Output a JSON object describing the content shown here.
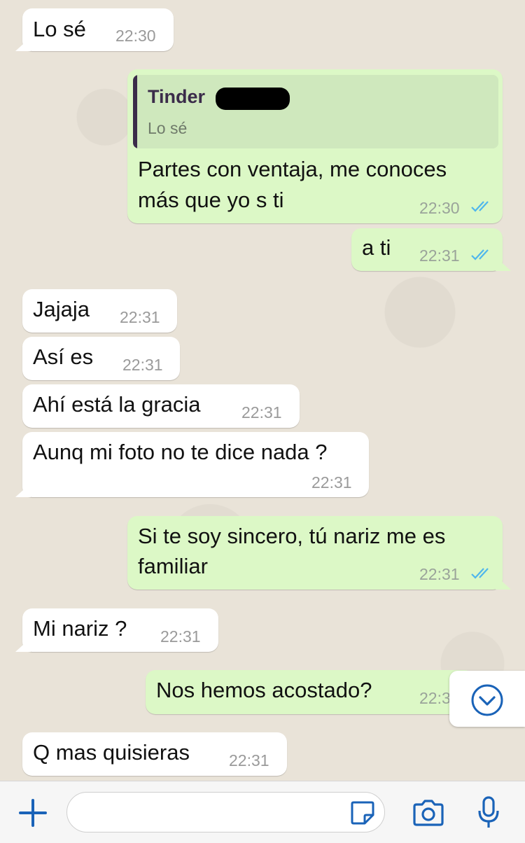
{
  "colors": {
    "outgoing_bubble": "#dcf8c6",
    "incoming_bubble": "#ffffff",
    "wallpaper": "#e9e3d8",
    "read_ticks": "#4fb6ec",
    "accent": "#1a63b8"
  },
  "messages": [
    {
      "direction": "in",
      "text": "Lo sé",
      "time": "22:30"
    },
    {
      "direction": "out",
      "quote": {
        "sender": "Tinder",
        "text": "Lo sé"
      },
      "text_lines": [
        "Partes con ventaja, me conoces",
        "más que yo s ti"
      ],
      "time": "22:30",
      "status": "read-double-check"
    },
    {
      "direction": "out",
      "text": "a ti",
      "time": "22:31",
      "status": "read-double-check"
    },
    {
      "direction": "in",
      "text": "Jajaja",
      "time": "22:31"
    },
    {
      "direction": "in",
      "text": "Así es",
      "time": "22:31"
    },
    {
      "direction": "in",
      "text": "Ahí está la gracia",
      "time": "22:31"
    },
    {
      "direction": "in",
      "text": "Aunq mi foto no te dice nada ?",
      "time": "22:31"
    },
    {
      "direction": "out",
      "text_lines": [
        "Si te soy sincero, tú nariz me es",
        "familiar"
      ],
      "time": "22:31",
      "status": "read-double-check"
    },
    {
      "direction": "in",
      "text": "Mi nariz ?",
      "time": "22:31"
    },
    {
      "direction": "out",
      "text": "Nos hemos acostado?",
      "time": "22:3"
    },
    {
      "direction": "in",
      "text": "Q mas quisieras",
      "time": "22:31"
    }
  ],
  "scroll_button": {
    "icon": "chevron-down-circle-icon"
  },
  "input_bar": {
    "attach_icon": "plus-icon",
    "sticker_icon": "sticker-icon",
    "camera_icon": "camera-icon",
    "mic_icon": "microphone-icon",
    "message_value": ""
  }
}
